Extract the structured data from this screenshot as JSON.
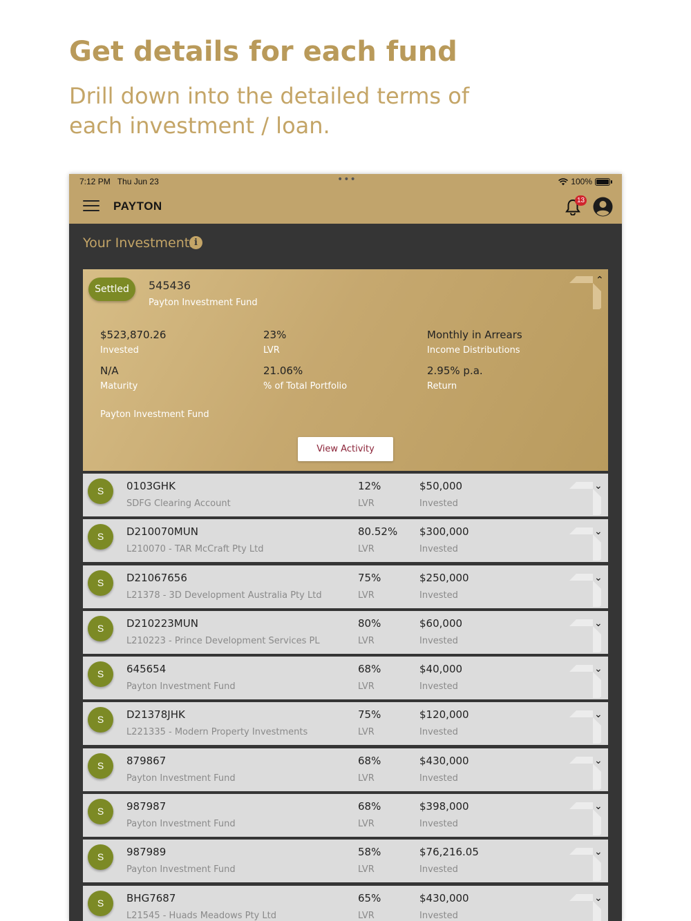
{
  "promo": {
    "title": "Get details for each fund",
    "subtitle": "Drill down into the detailed terms of each investment / loan."
  },
  "status_bar": {
    "time": "7:12 PM",
    "date": "Thu Jun 23",
    "battery": "100%"
  },
  "header": {
    "brand": "PAYTON",
    "notification_count": "13"
  },
  "section": {
    "title": "Your Investments"
  },
  "featured": {
    "status": "Settled",
    "id": "545436",
    "fund": "Payton Investment Fund",
    "invested_value": "$523,870.26",
    "invested_label": "Invested",
    "lvr_value": "23%",
    "lvr_label": "LVR",
    "income_value": "Monthly in Arrears",
    "income_label": "Income Distributions",
    "maturity_value": "N/A",
    "maturity_label": "Maturity",
    "portfolio_value": "21.06%",
    "portfolio_label": "% of Total Portfolio",
    "return_value": "2.95% p.a.",
    "return_label": "Return",
    "fund_footer": "Payton Investment Fund",
    "view_button": "View Activity"
  },
  "investments": [
    {
      "badge": "S",
      "id": "0103GHK",
      "sub": "SDFG Clearing Account",
      "lvr": "12%",
      "lvr_label": "LVR",
      "amount": "$50,000",
      "amount_label": "Invested"
    },
    {
      "badge": "S",
      "id": "D210070MUN",
      "sub": "L210070 - TAR McCraft Pty Ltd",
      "lvr": "80.52%",
      "lvr_label": "LVR",
      "amount": "$300,000",
      "amount_label": "Invested"
    },
    {
      "badge": "S",
      "id": "D21067656",
      "sub": "L21378 - 3D Development Australia Pty Ltd",
      "lvr": "75%",
      "lvr_label": "LVR",
      "amount": "$250,000",
      "amount_label": "Invested"
    },
    {
      "badge": "S",
      "id": "D210223MUN",
      "sub": "L210223 - Prince Development Services PL",
      "lvr": "80%",
      "lvr_label": "LVR",
      "amount": "$60,000",
      "amount_label": "Invested"
    },
    {
      "badge": "S",
      "id": "645654",
      "sub": "Payton Investment Fund",
      "lvr": "68%",
      "lvr_label": "LVR",
      "amount": "$40,000",
      "amount_label": "Invested"
    },
    {
      "badge": "S",
      "id": "D21378JHK",
      "sub": "L221335 - Modern Property Investments",
      "lvr": "75%",
      "lvr_label": "LVR",
      "amount": "$120,000",
      "amount_label": "Invested"
    },
    {
      "badge": "S",
      "id": "879867",
      "sub": "Payton Investment Fund",
      "lvr": "68%",
      "lvr_label": "LVR",
      "amount": "$430,000",
      "amount_label": "Invested"
    },
    {
      "badge": "S",
      "id": "987987",
      "sub": "Payton Investment Fund",
      "lvr": "68%",
      "lvr_label": "LVR",
      "amount": "$398,000",
      "amount_label": "Invested"
    },
    {
      "badge": "S",
      "id": "987989",
      "sub": "Payton Investment Fund",
      "lvr": "58%",
      "lvr_label": "LVR",
      "amount": "$76,216.05",
      "amount_label": "Invested"
    },
    {
      "badge": "S",
      "id": "BHG7687",
      "sub": "L21545 - Huads Meadows Pty Ltd",
      "lvr": "65%",
      "lvr_label": "LVR",
      "amount": "$430,000",
      "amount_label": "Invested"
    }
  ],
  "colors": {
    "gold": "#c1a46c",
    "olive": "#7c8a25",
    "dark_bg": "#353535",
    "row_bg": "#dcdcdc",
    "badge_red": "#d0252d"
  },
  "icons": {
    "menu": "hamburger-menu-icon",
    "bell": "bell-icon",
    "account": "account-circle-icon",
    "info": "info-icon",
    "chevron_up": "chevron-up-icon",
    "chevron_down": "chevron-down-icon"
  }
}
